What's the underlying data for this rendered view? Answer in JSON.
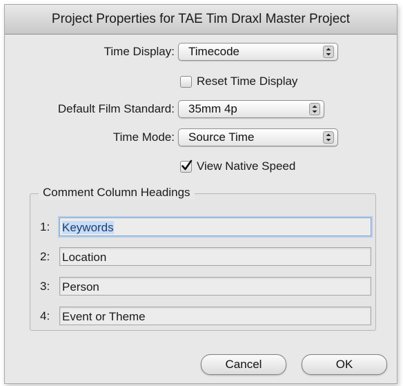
{
  "dialog": {
    "title": "Project Properties for TAE Tim Draxl Master Project"
  },
  "settings": {
    "time_display": {
      "label": "Time Display:",
      "value": "Timecode"
    },
    "reset_time_display": {
      "label": "Reset Time Display",
      "checked": false
    },
    "film_standard": {
      "label": "Default Film Standard:",
      "value": "35mm 4p"
    },
    "time_mode": {
      "label": "Time Mode:",
      "value": "Source Time"
    },
    "view_native_speed": {
      "label": "View Native Speed",
      "checked": true
    }
  },
  "comments": {
    "title": "Comment Column Headings",
    "rows": [
      {
        "num": "1:",
        "value": "Keywords"
      },
      {
        "num": "2:",
        "value": "Location"
      },
      {
        "num": "3:",
        "value": "Person"
      },
      {
        "num": "4:",
        "value": "Event or Theme"
      }
    ]
  },
  "buttons": {
    "cancel": "Cancel",
    "ok": "OK"
  },
  "icons": {
    "popup_arrows": "up-down-arrows-icon",
    "checkmark": "checkmark-icon"
  }
}
